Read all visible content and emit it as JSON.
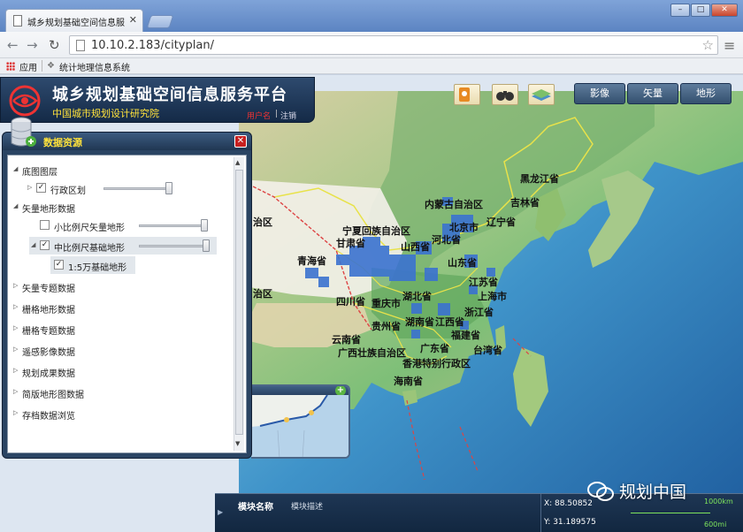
{
  "browser": {
    "tab_title": "城乡规划基础空间信息服务",
    "url": "10.10.2.183/cityplan/",
    "bookmarks": [
      "应用",
      "统计地理信息系统"
    ]
  },
  "header": {
    "title": "城乡规划基础空间信息服务平台",
    "subtitle": "中国城市规划设计研究院",
    "login": "用户名",
    "logout": "注销"
  },
  "map_buttons": [
    "影像",
    "矢量",
    "地形"
  ],
  "panel": {
    "title": "数据资源",
    "items": [
      {
        "label": "底图图层",
        "expanded": true
      },
      {
        "label": "行政区划",
        "checked": true,
        "opacity": 0.9
      },
      {
        "label": "矢量地形数据",
        "expanded": true
      },
      {
        "label": "小比例尺矢量地形",
        "checked": false,
        "opacity": 1.0
      },
      {
        "label": "中比例尺基础地形",
        "checked": true,
        "opacity": 1.0
      },
      {
        "label": "1:5万基础地形",
        "checked": true
      },
      {
        "label": "矢量专题数据"
      },
      {
        "label": "栅格地形数据"
      },
      {
        "label": "栅格专题数据"
      },
      {
        "label": "遥感影像数据"
      },
      {
        "label": "规划成果数据"
      },
      {
        "label": "简版地形图数据"
      },
      {
        "label": "存档数据浏览"
      }
    ]
  },
  "map_labels": [
    {
      "text": "黑龙江省"
    },
    {
      "text": "吉林省"
    },
    {
      "text": "内蒙古自治区"
    },
    {
      "text": "辽宁省"
    },
    {
      "text": "宁夏回族自治区"
    },
    {
      "text": "甘肃省"
    },
    {
      "text": "山西省"
    },
    {
      "text": "河北省"
    },
    {
      "text": "北京市"
    },
    {
      "text": "青海省"
    },
    {
      "text": "山东省"
    },
    {
      "text": "江苏省"
    },
    {
      "text": "上海市"
    },
    {
      "text": "四川省"
    },
    {
      "text": "重庆市"
    },
    {
      "text": "湖北省"
    },
    {
      "text": "浙江省"
    },
    {
      "text": "江西省"
    },
    {
      "text": "福建省"
    },
    {
      "text": "贵州省"
    },
    {
      "text": "湖南省"
    },
    {
      "text": "云南省"
    },
    {
      "text": "广东省"
    },
    {
      "text": "台湾省"
    },
    {
      "text": "广西壮族自治区"
    },
    {
      "text": "香港特别行政区"
    },
    {
      "text": "海南省"
    },
    {
      "text": "治区"
    },
    {
      "text": "治区"
    }
  ],
  "statusbar": {
    "module_name": "模块名称",
    "module_desc": "模块描述",
    "x": "X: 88.50852",
    "y": "Y: 31.189575",
    "scale_km": "1000km",
    "scale_mi": "600mi"
  },
  "watermark": "规划中国",
  "colors": {
    "header_bg": "#1e3654",
    "accent_yellow": "#ffe23b",
    "sea": "#2a6fb3"
  }
}
